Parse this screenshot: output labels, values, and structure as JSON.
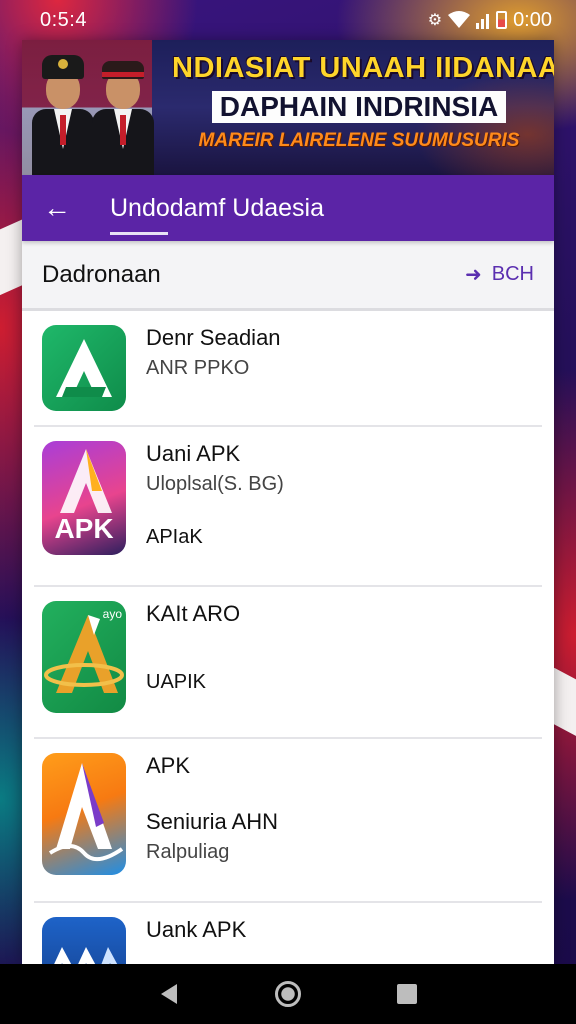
{
  "status_bar": {
    "time": "0:5:4",
    "right_text": "0:00",
    "icons": [
      "gear-icon",
      "wifi-icon",
      "signal-icon",
      "battery-icon"
    ]
  },
  "banner": {
    "line1": "NDIASIAT UNAAH IIDANAA",
    "line2": "DAPHAIN INDRINSIA",
    "line3": "MAREIR LAIRELENE SUUMUSURIS"
  },
  "toolbar": {
    "back_icon": "arrow-left-icon",
    "title": "Undodamf Udaesia",
    "color": "#5b24a6"
  },
  "section": {
    "title": "Dadronaan",
    "action_label": "BCH"
  },
  "apps": [
    {
      "name": "Denr Seadian",
      "sub": "ANR PPKO",
      "extra": ""
    },
    {
      "name": "Uani APK",
      "sub": "Uloplsal(S. BG)",
      "extra": "APIaK",
      "icon_label": "APK"
    },
    {
      "name": "KAIt ARO",
      "sub": "",
      "extra": "UAPIK",
      "icon_badge": "ayo"
    },
    {
      "name": "APK",
      "sub": "Seniuria AHN",
      "extra": "Ralpuliag"
    },
    {
      "name": "Uank APK",
      "sub": "",
      "extra": ""
    }
  ],
  "nav_bar": {
    "icons": [
      "back-triangle-icon",
      "home-circle-icon",
      "recents-square-icon"
    ]
  }
}
